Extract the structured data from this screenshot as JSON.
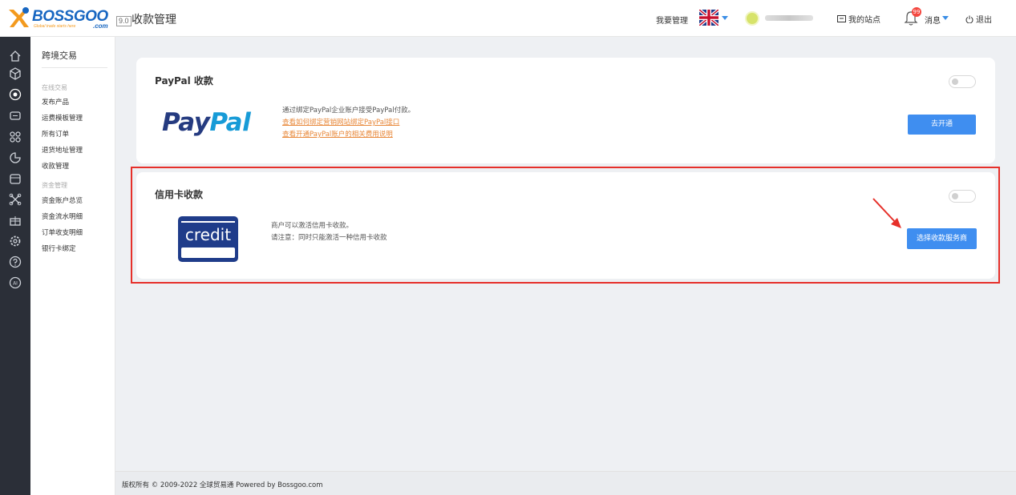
{
  "header": {
    "brand": "BOSSGOO",
    "brand_tagline": "Global trade starts here",
    "brand_suffix": ".com",
    "version": "9.0",
    "page_title": "收款管理",
    "manage_label": "我要管理",
    "my_site": "我的站点",
    "notifications": {
      "label": "消息",
      "count": "99"
    },
    "logout": "退出"
  },
  "rail_icons": [
    "home-icon",
    "cube-icon",
    "globe-icon",
    "chat-icon",
    "grid-icon",
    "pie-chart-icon",
    "store-icon",
    "network-icon",
    "gift-icon",
    "settings-icon",
    "help-icon",
    "ai-icon"
  ],
  "sidebar": {
    "title": "跨境交易",
    "groups": [
      {
        "label": "在线交易",
        "items": [
          "发布产品",
          "运费模板管理",
          "所有订单",
          "退货地址管理",
          "收款管理"
        ]
      },
      {
        "label": "资金管理",
        "items": [
          "资金账户总览",
          "资金流水明细",
          "订单收支明细",
          "银行卡绑定"
        ]
      }
    ]
  },
  "paypal_card": {
    "title": "PayPal 收款",
    "logo_pay": "Pay",
    "logo_pal": "Pal",
    "desc": "通过绑定PayPal企业账户接受PayPal付款。",
    "link1": "查看如何绑定营销网站绑定PayPal接口",
    "link2": "查看开通PayPal账户的相关费用说明",
    "button": "去开通",
    "enabled": false
  },
  "credit_card": {
    "title": "信用卡收款",
    "logo_text": "credit",
    "desc1": "商户可以激活信用卡收款。",
    "desc2": "请注意：同时只能激活一种信用卡收款",
    "button": "选择收款服务商",
    "enabled": false
  },
  "colors": {
    "accent": "#3f8ef0",
    "highlight": "#e6302a",
    "link": "#e8883a"
  },
  "footer": {
    "text": "版权所有 © 2009-2022 全球贸易通 Powered by Bossgoo.com"
  }
}
